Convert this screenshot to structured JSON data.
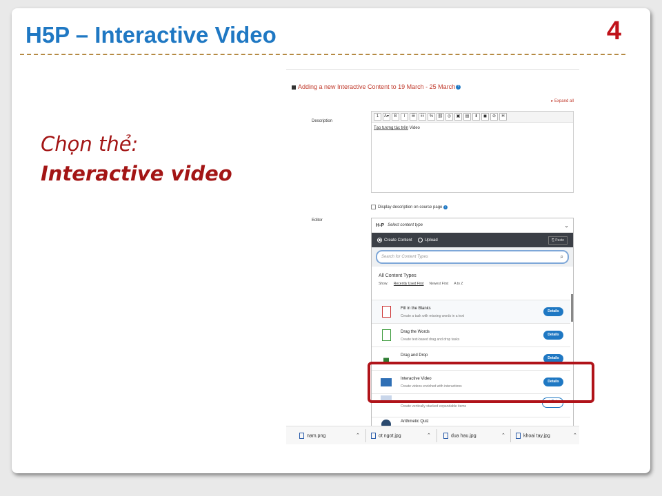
{
  "slide": {
    "title": "H5P – Interactive  Video",
    "page_number": "4",
    "left_line1": "Chọn thẻ:",
    "left_line2": "Interactive video"
  },
  "moodle": {
    "heading": "Adding a new Interactive Content to 19 March - 25 March",
    "expand_all": "Expand all",
    "description_label": "Description",
    "description_text_underlined": "Tạo tương tác trên",
    "description_text_rest": " Video",
    "display_checkbox_label": "Display description on course page",
    "editor_label": "Editor",
    "toolbar_icons": [
      "1",
      "A▾",
      "B",
      "I",
      "☰",
      "☷",
      "%",
      "⛓",
      "◎",
      "▣",
      "▤",
      "⬇",
      "◼",
      "⊘",
      "H"
    ]
  },
  "h5p": {
    "logo": "H-P",
    "select_placeholder": "Select content type",
    "create_content": "Create Content",
    "upload": "Upload",
    "paste": "Paste",
    "search_placeholder": "Search for Content Types",
    "all_content_types": "All Content Types",
    "show_label": "Show:",
    "sort_recent": "Recently Used First",
    "sort_newest": "Newest First",
    "sort_az": "A to Z",
    "items": [
      {
        "name": "Fill in the Blanks",
        "desc": "Create a task with missing words in a text",
        "button": "Details"
      },
      {
        "name": "Drag the Words",
        "desc": "Create text-based drag and drop tasks",
        "button": "Details"
      },
      {
        "name": "Drag and Drop",
        "desc": "",
        "button": "Details"
      },
      {
        "name": "Interactive Video",
        "desc": "Create videos enriched with interactions",
        "button": "Details"
      },
      {
        "name": "",
        "desc": "Create vertically stacked expandable items",
        "button": "+ Get"
      },
      {
        "name": "Arithmetic Quiz",
        "desc": "",
        "button": ""
      }
    ]
  },
  "downloads": [
    {
      "name": "nam.png"
    },
    {
      "name": "ot ngot.jpg"
    },
    {
      "name": "dua hau.jpg"
    },
    {
      "name": "khoai tay.jpg"
    }
  ],
  "colors": {
    "title": "#1f78c3",
    "accent_red": "#a31515",
    "highlight": "#b01319",
    "button_blue": "#1f78c3"
  }
}
